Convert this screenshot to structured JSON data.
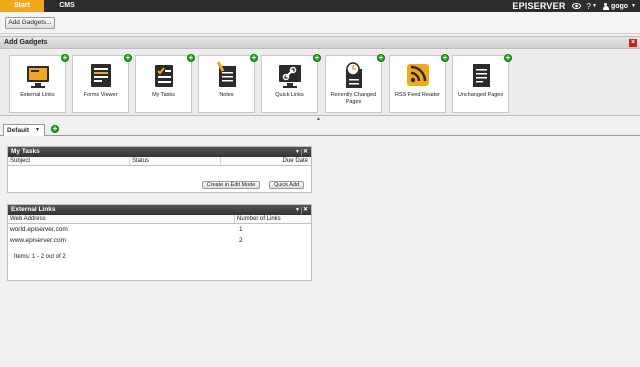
{
  "topbar": {
    "tabs": [
      {
        "label": "Start",
        "active": true
      },
      {
        "label": "CMS",
        "active": false
      }
    ],
    "brand": "EPISERVER",
    "help_label": "?",
    "user_label": "gogo",
    "accent_color": "#f2a81d"
  },
  "toolbar": {
    "add_gadgets_button": "Add Gadgets..."
  },
  "add_gadgets": {
    "title": "Add Gadgets",
    "items": [
      {
        "label": "External Links",
        "icon": "external-links-icon"
      },
      {
        "label": "Forms Viewer",
        "icon": "forms-viewer-icon"
      },
      {
        "label": "My Tasks",
        "icon": "tasks-icon"
      },
      {
        "label": "Notes",
        "icon": "notes-icon"
      },
      {
        "label": "Quick Links",
        "icon": "quick-links-icon"
      },
      {
        "label": "Recently Changed Pages",
        "icon": "recently-changed-icon"
      },
      {
        "label": "RSS Feed Reader",
        "icon": "rss-icon"
      },
      {
        "label": "Unchanged Pages",
        "icon": "unchanged-pages-icon"
      }
    ]
  },
  "dashboard": {
    "tab_label": "Default"
  },
  "my_tasks": {
    "title": "My Tasks",
    "columns": [
      "Subject",
      "Status",
      "Due Date"
    ],
    "create_button": "Create in Edit Mode",
    "quick_add_button": "Quick Add"
  },
  "external_links": {
    "title": "External Links",
    "columns": [
      "Web Address",
      "Number of Links"
    ],
    "rows": [
      {
        "address": "world.episerver.com",
        "count": "1"
      },
      {
        "address": "www.episerver.com",
        "count": "2"
      }
    ],
    "items_summary": "Items: 1 - 2 out of 2"
  }
}
